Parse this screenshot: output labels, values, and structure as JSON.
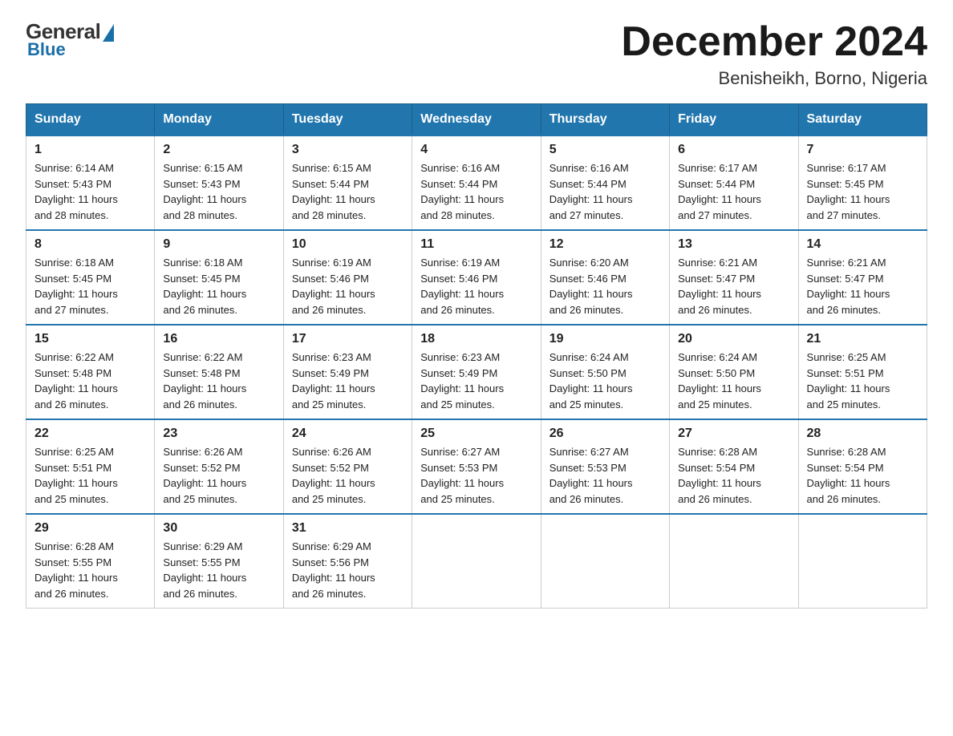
{
  "logo": {
    "general": "General",
    "blue": "Blue"
  },
  "title": "December 2024",
  "location": "Benisheikh, Borno, Nigeria",
  "days_of_week": [
    "Sunday",
    "Monday",
    "Tuesday",
    "Wednesday",
    "Thursday",
    "Friday",
    "Saturday"
  ],
  "weeks": [
    [
      {
        "day": "1",
        "sunrise": "6:14 AM",
        "sunset": "5:43 PM",
        "daylight": "11 hours and 28 minutes."
      },
      {
        "day": "2",
        "sunrise": "6:15 AM",
        "sunset": "5:43 PM",
        "daylight": "11 hours and 28 minutes."
      },
      {
        "day": "3",
        "sunrise": "6:15 AM",
        "sunset": "5:44 PM",
        "daylight": "11 hours and 28 minutes."
      },
      {
        "day": "4",
        "sunrise": "6:16 AM",
        "sunset": "5:44 PM",
        "daylight": "11 hours and 28 minutes."
      },
      {
        "day": "5",
        "sunrise": "6:16 AM",
        "sunset": "5:44 PM",
        "daylight": "11 hours and 27 minutes."
      },
      {
        "day": "6",
        "sunrise": "6:17 AM",
        "sunset": "5:44 PM",
        "daylight": "11 hours and 27 minutes."
      },
      {
        "day": "7",
        "sunrise": "6:17 AM",
        "sunset": "5:45 PM",
        "daylight": "11 hours and 27 minutes."
      }
    ],
    [
      {
        "day": "8",
        "sunrise": "6:18 AM",
        "sunset": "5:45 PM",
        "daylight": "11 hours and 27 minutes."
      },
      {
        "day": "9",
        "sunrise": "6:18 AM",
        "sunset": "5:45 PM",
        "daylight": "11 hours and 26 minutes."
      },
      {
        "day": "10",
        "sunrise": "6:19 AM",
        "sunset": "5:46 PM",
        "daylight": "11 hours and 26 minutes."
      },
      {
        "day": "11",
        "sunrise": "6:19 AM",
        "sunset": "5:46 PM",
        "daylight": "11 hours and 26 minutes."
      },
      {
        "day": "12",
        "sunrise": "6:20 AM",
        "sunset": "5:46 PM",
        "daylight": "11 hours and 26 minutes."
      },
      {
        "day": "13",
        "sunrise": "6:21 AM",
        "sunset": "5:47 PM",
        "daylight": "11 hours and 26 minutes."
      },
      {
        "day": "14",
        "sunrise": "6:21 AM",
        "sunset": "5:47 PM",
        "daylight": "11 hours and 26 minutes."
      }
    ],
    [
      {
        "day": "15",
        "sunrise": "6:22 AM",
        "sunset": "5:48 PM",
        "daylight": "11 hours and 26 minutes."
      },
      {
        "day": "16",
        "sunrise": "6:22 AM",
        "sunset": "5:48 PM",
        "daylight": "11 hours and 26 minutes."
      },
      {
        "day": "17",
        "sunrise": "6:23 AM",
        "sunset": "5:49 PM",
        "daylight": "11 hours and 25 minutes."
      },
      {
        "day": "18",
        "sunrise": "6:23 AM",
        "sunset": "5:49 PM",
        "daylight": "11 hours and 25 minutes."
      },
      {
        "day": "19",
        "sunrise": "6:24 AM",
        "sunset": "5:50 PM",
        "daylight": "11 hours and 25 minutes."
      },
      {
        "day": "20",
        "sunrise": "6:24 AM",
        "sunset": "5:50 PM",
        "daylight": "11 hours and 25 minutes."
      },
      {
        "day": "21",
        "sunrise": "6:25 AM",
        "sunset": "5:51 PM",
        "daylight": "11 hours and 25 minutes."
      }
    ],
    [
      {
        "day": "22",
        "sunrise": "6:25 AM",
        "sunset": "5:51 PM",
        "daylight": "11 hours and 25 minutes."
      },
      {
        "day": "23",
        "sunrise": "6:26 AM",
        "sunset": "5:52 PM",
        "daylight": "11 hours and 25 minutes."
      },
      {
        "day": "24",
        "sunrise": "6:26 AM",
        "sunset": "5:52 PM",
        "daylight": "11 hours and 25 minutes."
      },
      {
        "day": "25",
        "sunrise": "6:27 AM",
        "sunset": "5:53 PM",
        "daylight": "11 hours and 25 minutes."
      },
      {
        "day": "26",
        "sunrise": "6:27 AM",
        "sunset": "5:53 PM",
        "daylight": "11 hours and 26 minutes."
      },
      {
        "day": "27",
        "sunrise": "6:28 AM",
        "sunset": "5:54 PM",
        "daylight": "11 hours and 26 minutes."
      },
      {
        "day": "28",
        "sunrise": "6:28 AM",
        "sunset": "5:54 PM",
        "daylight": "11 hours and 26 minutes."
      }
    ],
    [
      {
        "day": "29",
        "sunrise": "6:28 AM",
        "sunset": "5:55 PM",
        "daylight": "11 hours and 26 minutes."
      },
      {
        "day": "30",
        "sunrise": "6:29 AM",
        "sunset": "5:55 PM",
        "daylight": "11 hours and 26 minutes."
      },
      {
        "day": "31",
        "sunrise": "6:29 AM",
        "sunset": "5:56 PM",
        "daylight": "11 hours and 26 minutes."
      },
      null,
      null,
      null,
      null
    ]
  ],
  "labels": {
    "sunrise": "Sunrise:",
    "sunset": "Sunset:",
    "daylight": "Daylight:"
  }
}
